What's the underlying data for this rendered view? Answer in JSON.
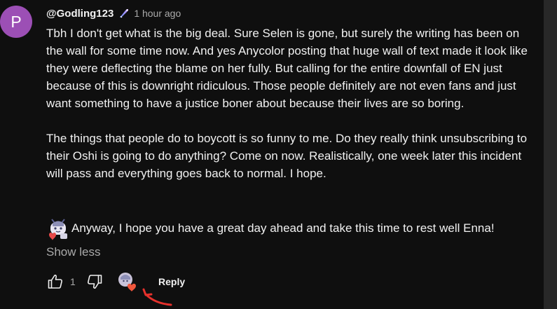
{
  "comment": {
    "avatar_letter": "P",
    "author": "@Godling123",
    "badge_icon": "member-badge-icon",
    "timestamp": "1 hour ago",
    "paragraphs": [
      "Tbh I don't get what is the big deal. Sure Selen is gone, but surely the writing has been on the wall for some time now. And yes Anycolor posting that huge wall of text made it look like they were deflecting the blame on her fully. But calling for the entire downfall of EN just because of this is downright ridiculous. Those people definitely are not even fans and just want something to have a justice boner about because their lives are so boring.",
      "The things that people do to boycott is so funny to me. Do they really think unsubscribing to their Oshi is going to do anything? Come on now. Realistically, one week later this incident will pass and everything goes back to normal. I hope."
    ],
    "final_line": "Anyway, I hope you have a great day ahead and take this time to rest well Enna!",
    "show_less": "Show less"
  },
  "actions": {
    "like_count": "1",
    "reply_label": "Reply"
  },
  "colors": {
    "background": "#0f0f0f",
    "text": "#f1f1f1",
    "secondary_text": "#aaaaaa",
    "avatar": "#9c4fb5",
    "arrow": "#e5312c",
    "heart": "#f0563c"
  }
}
